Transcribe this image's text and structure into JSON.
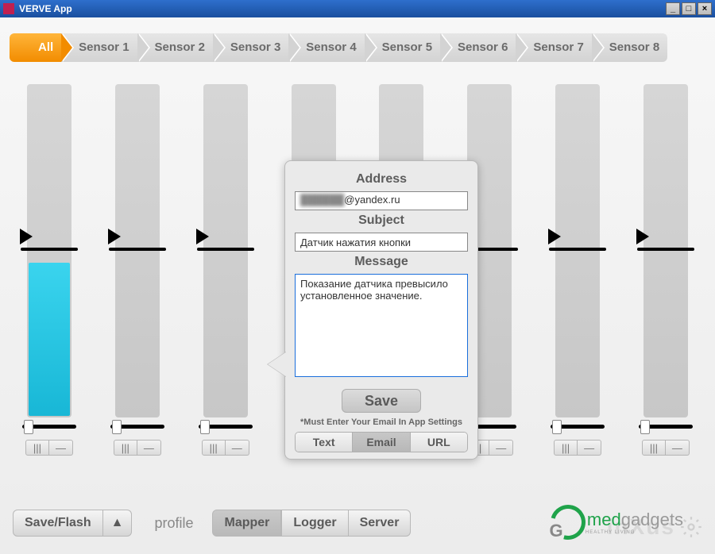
{
  "window": {
    "title": "VERVE App"
  },
  "tabs": [
    "All",
    "Sensor 1",
    "Sensor 2",
    "Sensor 3",
    "Sensor 4",
    "Sensor 5",
    "Sensor 6",
    "Sensor 7",
    "Sensor 8"
  ],
  "active_tab": 0,
  "sensors": [
    {
      "fill_pct": 46,
      "threshold_pct": 50
    },
    {
      "fill_pct": 0,
      "threshold_pct": 50
    },
    {
      "fill_pct": 0,
      "threshold_pct": 50
    },
    {
      "fill_pct": 0,
      "threshold_pct": 50
    },
    {
      "fill_pct": 0,
      "threshold_pct": 50
    },
    {
      "fill_pct": 0,
      "threshold_pct": 50
    },
    {
      "fill_pct": 0,
      "threshold_pct": 50
    },
    {
      "fill_pct": 0,
      "threshold_pct": 50
    }
  ],
  "dialog": {
    "labels": {
      "address": "Address",
      "subject": "Subject",
      "message": "Message"
    },
    "address_masked": "██████",
    "address_tail": "@yandex.ru",
    "subject_value": "Датчик нажатия кнопки",
    "message_value": "Показание датчика превысило установленное значение.",
    "save_label": "Save",
    "note": "*Must Enter Your Email In App Settings",
    "tabs": {
      "text": "Text",
      "email": "Email",
      "url": "URL",
      "selected": "email"
    }
  },
  "bottom": {
    "save_flash": "Save/Flash",
    "arrow": "▲",
    "profile": "profile",
    "mapper": "Mapper",
    "logger": "Logger",
    "server": "Server"
  },
  "watermark": {
    "brand": "inXus",
    "med_part1": "med",
    "med_part2": "gadgets",
    "med_sub": "HEALTHY LIVING"
  },
  "icons": {
    "grip": "|||",
    "minus": "—"
  }
}
